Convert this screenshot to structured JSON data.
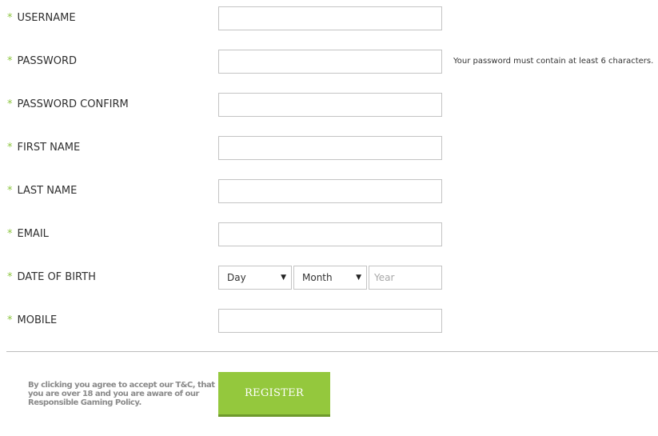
{
  "form": {
    "required_marker": "*",
    "fields": {
      "username": {
        "label": "USERNAME",
        "value": "",
        "placeholder": ""
      },
      "password": {
        "label": "PASSWORD",
        "value": "",
        "placeholder": "",
        "hint": "Your password must contain at least 6 characters."
      },
      "password_confirm": {
        "label": "PASSWORD CONFIRM",
        "value": "",
        "placeholder": ""
      },
      "first_name": {
        "label": "FIRST NAME",
        "value": "",
        "placeholder": ""
      },
      "last_name": {
        "label": "LAST NAME",
        "value": "",
        "placeholder": ""
      },
      "email": {
        "label": "EMAIL",
        "value": "",
        "placeholder": ""
      },
      "date_of_birth": {
        "label": "DATE OF BIRTH",
        "day": {
          "selected": "Day"
        },
        "month": {
          "selected": "Month"
        },
        "year": {
          "placeholder": "Year",
          "value": ""
        }
      },
      "mobile": {
        "label": "MOBILE",
        "value": "",
        "placeholder": ""
      }
    },
    "terms_text": "By clicking you agree to accept our T&C, that you are over 18 and you are aware of our Responsible Gaming Policy.",
    "register_label": "REGISTER"
  },
  "icons": {
    "caret": "▼",
    "required": "asterisk"
  },
  "colors": {
    "accent": "#94c83d",
    "accent_dark": "#6e9a2c",
    "required_star": "#8cc63f",
    "border": "#c4c4c4"
  }
}
